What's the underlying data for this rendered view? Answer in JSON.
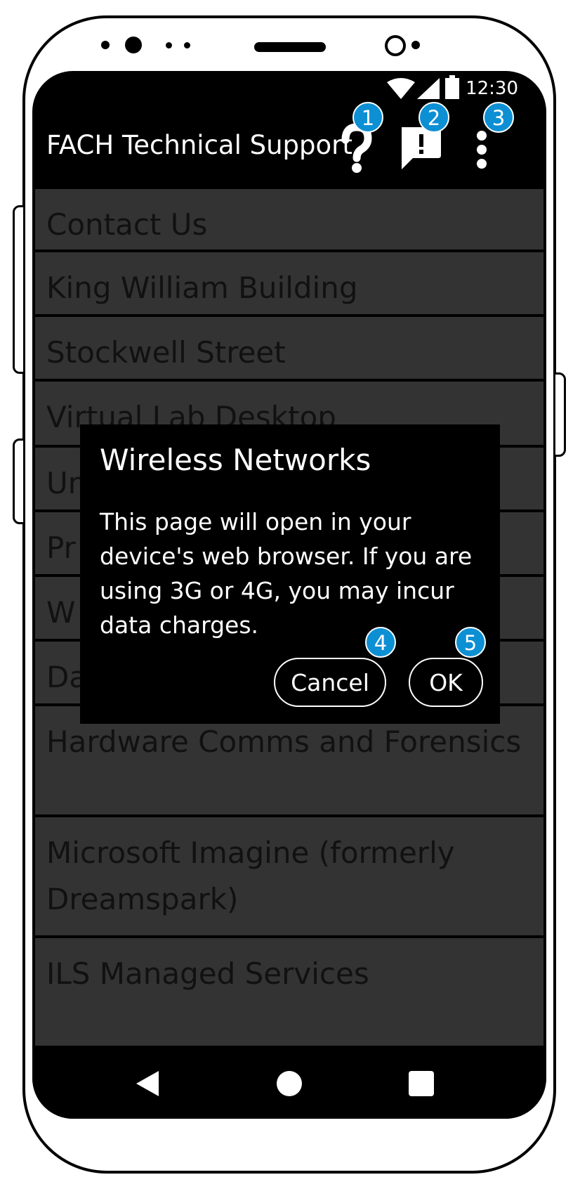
{
  "status_bar": {
    "time": "12:30"
  },
  "app_bar": {
    "title": "FACH Technical Support",
    "help_icon": "help-icon",
    "feedback_icon": "feedback-icon",
    "overflow_icon": "more-vert-icon"
  },
  "list": {
    "items": [
      {
        "label": "Contact Us"
      },
      {
        "label": "King William Building"
      },
      {
        "label": "Stockwell Street"
      },
      {
        "label": "Virtual Lab Desktop"
      },
      {
        "label": "Un"
      },
      {
        "label": "Pr"
      },
      {
        "label": "W"
      },
      {
        "label": "Da"
      },
      {
        "label": "Hardware Comms and Forensics"
      },
      {
        "label": "Microsoft Imagine (formerly Dreamspark)"
      },
      {
        "label": "ILS Managed Services"
      }
    ]
  },
  "dialog": {
    "title": "Wireless Networks",
    "message": "This page will open in your device's web browser. If you are using 3G or 4G, you may incur data charges.",
    "cancel_label": "Cancel",
    "ok_label": "OK"
  },
  "badges": [
    "1",
    "2",
    "3",
    "4",
    "5"
  ],
  "colors": {
    "badge": "#0d8fd4",
    "list_bg": "#333333",
    "screen_bg": "#000000"
  }
}
